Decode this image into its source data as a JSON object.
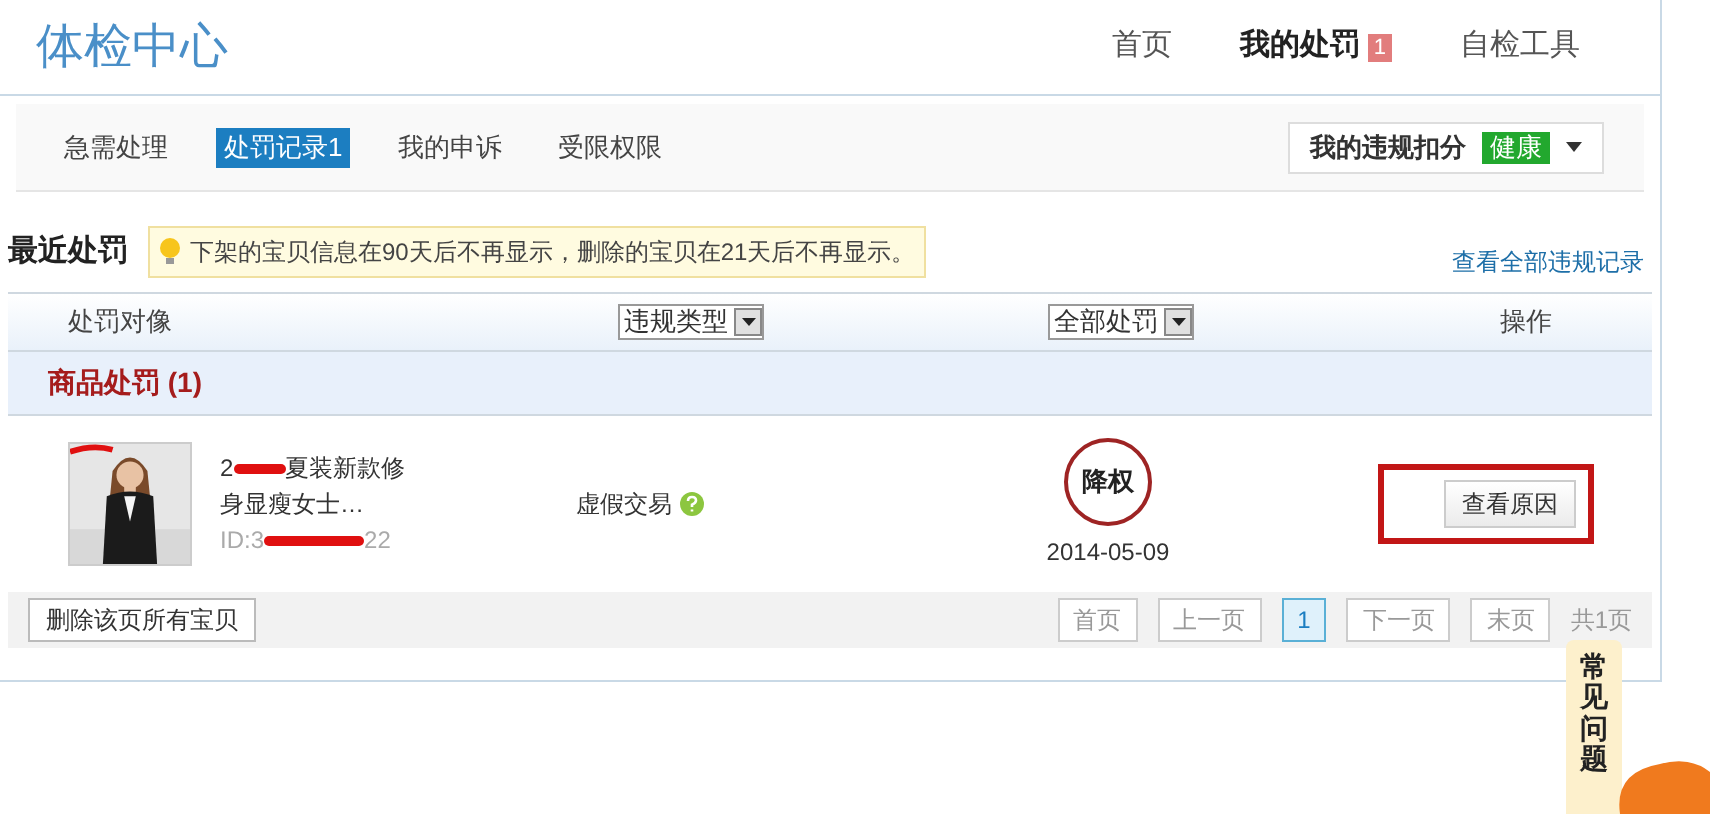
{
  "header": {
    "title": "体检中心",
    "nav": [
      {
        "label": "首页",
        "selected": false
      },
      {
        "label": "我的处罚",
        "selected": true,
        "badge": "1"
      },
      {
        "label": "自检工具",
        "selected": false
      }
    ]
  },
  "subnav": {
    "tabs": [
      {
        "label": "急需处理",
        "selected": false
      },
      {
        "label": "处罚记录1",
        "selected": true
      },
      {
        "label": "我的申诉",
        "selected": false
      },
      {
        "label": "受限权限",
        "selected": false
      }
    ],
    "score": {
      "label": "我的违规扣分",
      "status": "健康",
      "color": "#22a82e"
    }
  },
  "section": {
    "title": "最近处罚",
    "notice": "下架的宝贝信息在90天后不再显示，删除的宝贝在21天后不再显示。",
    "link": "查看全部违规记录"
  },
  "table": {
    "columns": [
      {
        "label": "处罚对像",
        "kind": "text"
      },
      {
        "label": "违规类型",
        "kind": "select"
      },
      {
        "label": "全部处罚",
        "kind": "select"
      },
      {
        "label": "操作",
        "kind": "text"
      }
    ],
    "group": "商品处罚 (1)",
    "rows": [
      {
        "picture": {
          "kind": "picture"
        },
        "title_parts": [
          "2",
          "夏装新款修"
        ],
        "title_line2": "身显瘦女士…",
        "id_parts": [
          "ID:3",
          "22"
        ],
        "type": "虚假交易",
        "penalty": "降权",
        "date": "2014-05-09",
        "action": "查看原因"
      }
    ]
  },
  "footer": {
    "delete_button": "删除该页所有宝贝",
    "pager": [
      {
        "label": "首页",
        "selected": false
      },
      {
        "label": "上一页",
        "selected": false
      },
      {
        "label": "1",
        "selected": true
      },
      {
        "label": "下一页",
        "selected": false
      },
      {
        "label": "末页",
        "selected": false
      }
    ],
    "total": "共1页"
  },
  "side_tab": "常见问题"
}
